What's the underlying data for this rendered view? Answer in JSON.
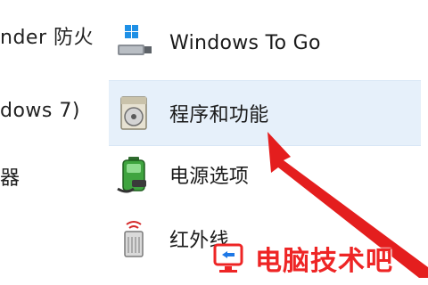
{
  "left_panel": {
    "line1": "nder 防火",
    "line2": "dows 7)",
    "line3": "器"
  },
  "items": [
    {
      "label": "Windows To Go",
      "icon": "usb-drive-icon"
    },
    {
      "label": "程序和功能",
      "icon": "programs-features-icon",
      "selected": true
    },
    {
      "label": "电源选项",
      "icon": "battery-power-icon"
    },
    {
      "label": "红外线",
      "icon": "infrared-icon"
    }
  ],
  "annotation": {
    "arrow_color": "#e41e1e"
  },
  "watermark": {
    "text": "电脑技术吧",
    "color": "#ee2525"
  }
}
